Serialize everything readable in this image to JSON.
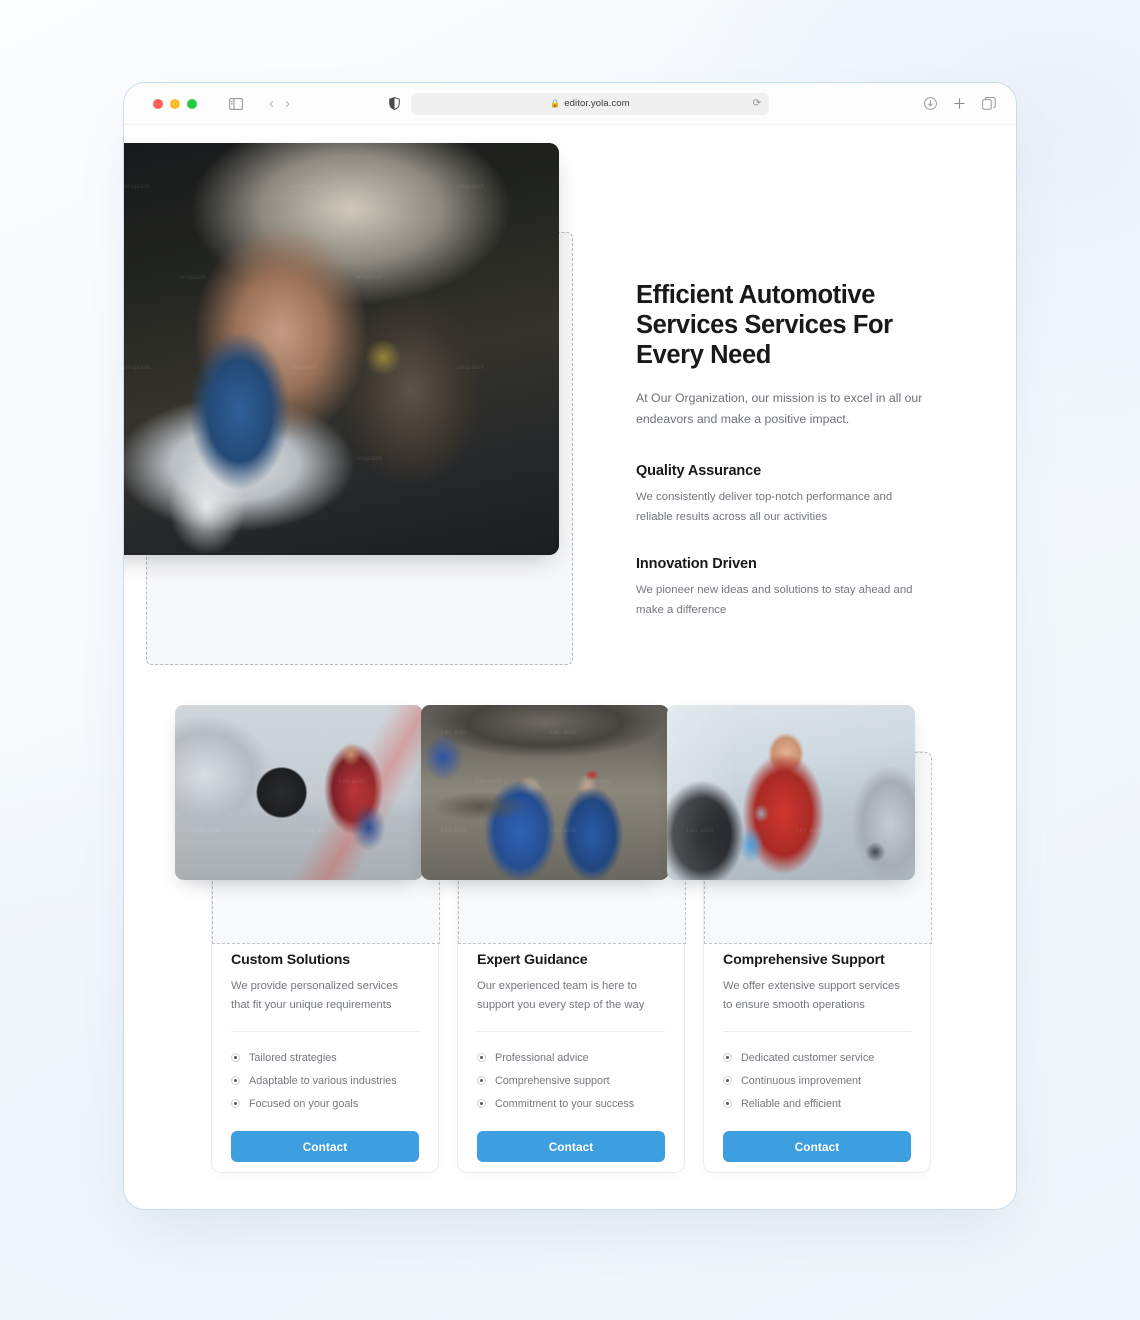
{
  "browser": {
    "url": "editor.yola.com",
    "lock_icon": "lock-icon",
    "reload_icon": "reload-icon",
    "traffic_lights": [
      "close-red",
      "minimize-yellow",
      "maximize-green"
    ],
    "sidebar_icon": "sidebar-toggle-icon",
    "back_icon": "back-chevron-icon",
    "forward_icon": "forward-chevron-icon",
    "shield_icon": "privacy-shield-icon",
    "download_icon": "download-icon",
    "new_tab_icon": "plus-icon",
    "tabs_icon": "tab-overview-icon"
  },
  "hero": {
    "heading": "Efficient Automotive Services Services For Every Need",
    "subheading": "At Our Organization, our mission is to excel in all our endeavors and make a positive impact.",
    "image_alt": "mechanic-working-under-car",
    "features": [
      {
        "title": "Quality Assurance",
        "text": "We consistently deliver top-notch performance and reliable results across all our activities"
      },
      {
        "title": "Innovation Driven",
        "text": "We pioneer new ideas and solutions to stay ahead and make a difference"
      }
    ]
  },
  "cards": [
    {
      "title": "Custom Solutions",
      "description": "We provide personalized services that fit your unique requirements",
      "bullets": [
        "Tailored strategies",
        "Adaptable to various industries",
        "Focused on your goals"
      ],
      "button": "Contact",
      "image_alt": "mechanic-changing-car-wheel"
    },
    {
      "title": "Expert Guidance",
      "description": "Our experienced team is here to support you every step of the way",
      "bullets": [
        "Professional advice",
        "Comprehensive support",
        "Commitment to your success"
      ],
      "button": "Contact",
      "image_alt": "two-mechanics-under-lifted-car"
    },
    {
      "title": "Comprehensive Support",
      "description": "We offer extensive support services to ensure smooth operations",
      "bullets": [
        "Dedicated customer service",
        "Continuous improvement",
        "Reliable and efficient"
      ],
      "button": "Contact",
      "image_alt": "smiling-mechanic-polishing-car"
    }
  ],
  "colors": {
    "accent": "#3d9ee0",
    "heading": "#18191b",
    "body_text": "#74787e",
    "window_border": "#c5ddf0",
    "dashed_outline": "#b9b9bd"
  }
}
